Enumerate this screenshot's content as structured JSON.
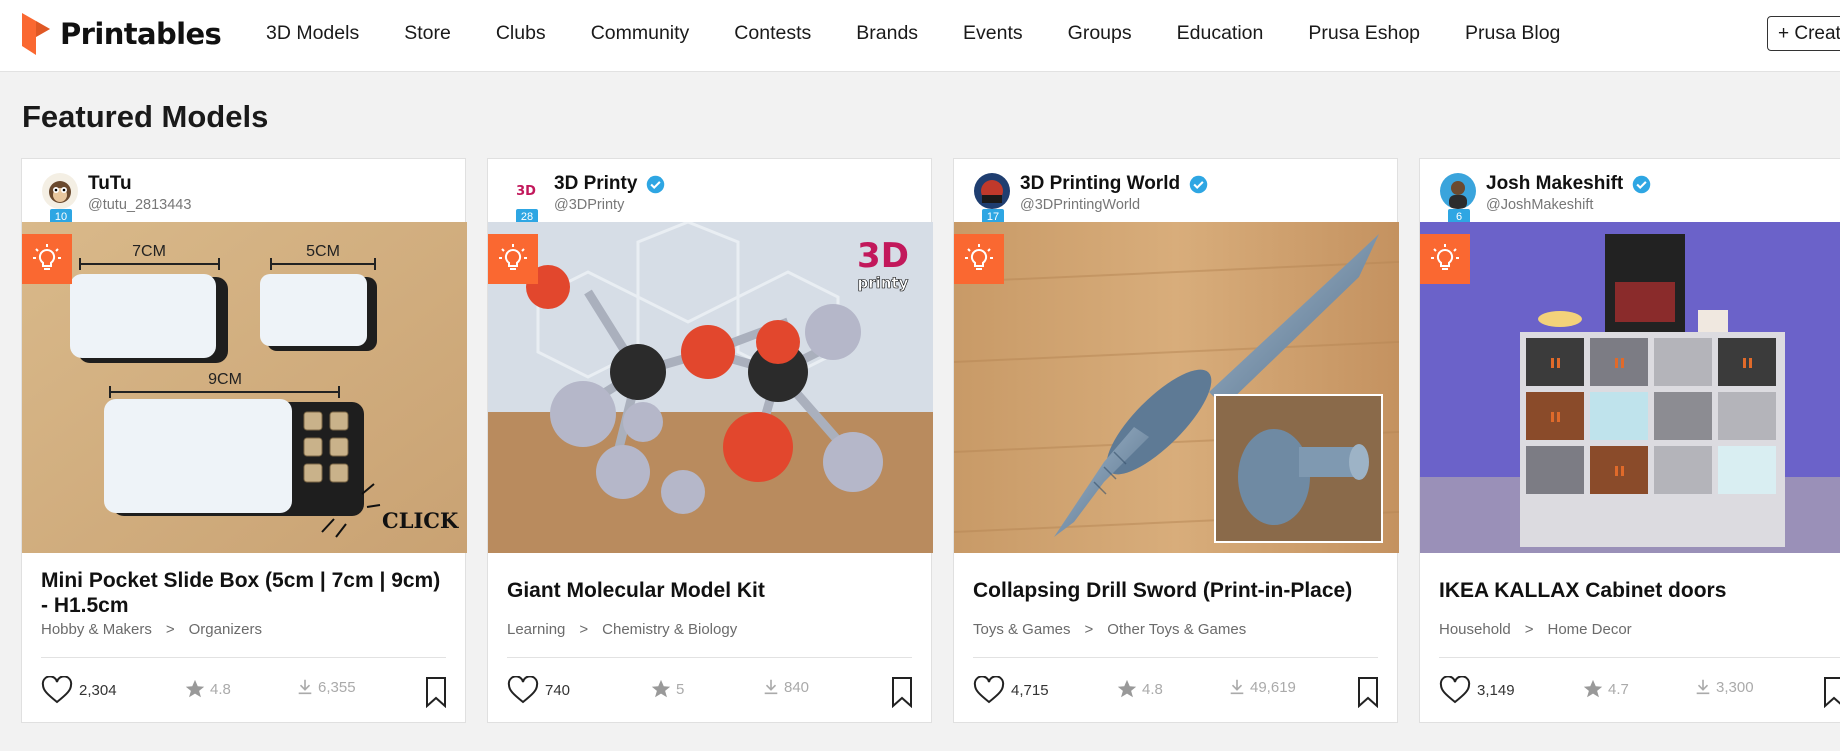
{
  "header": {
    "logo_text": "Printables",
    "nav": [
      "3D Models",
      "Store",
      "Clubs",
      "Community",
      "Contests",
      "Brands",
      "Events",
      "Groups",
      "Education",
      "Prusa Eshop",
      "Prusa Blog"
    ],
    "create_label": "+ Create"
  },
  "section_title": "Featured Models",
  "colors": {
    "brand": "#fa6831",
    "verified": "#2ea6e3"
  },
  "cards": [
    {
      "author": "TuTu",
      "handle": "@tutu_2813443",
      "level": "10",
      "verified": false,
      "title": "Mini Pocket Slide Box (5cm | 7cm | 9cm) - H1.5cm",
      "category": "Hobby & Makers",
      "subcategory": "Organizers",
      "likes": "2,304",
      "rating": "4.8",
      "downloads": "6,355",
      "image_labels": [
        "7CM",
        "5CM",
        "9CM",
        "CLICK"
      ]
    },
    {
      "author": "3D Printy",
      "handle": "@3DPrinty",
      "level": "28",
      "verified": true,
      "title": "Giant Molecular Model Kit",
      "category": "Learning",
      "subcategory": "Chemistry & Biology",
      "likes": "740",
      "rating": "5",
      "downloads": "840",
      "image_labels": [
        "3D",
        "printy"
      ]
    },
    {
      "author": "3D Printing World",
      "handle": "@3DPrintingWorld",
      "level": "17",
      "verified": true,
      "title": "Collapsing Drill Sword (Print-in-Place)",
      "category": "Toys & Games",
      "subcategory": "Other Toys & Games",
      "likes": "4,715",
      "rating": "4.8",
      "downloads": "49,619"
    },
    {
      "author": "Josh Makeshift",
      "handle": "@JoshMakeshift",
      "level": "6",
      "verified": true,
      "title": "IKEA KALLAX Cabinet doors",
      "category": "Household",
      "subcategory": "Home Decor",
      "likes": "3,149",
      "rating": "4.7",
      "downloads": "3,300"
    }
  ]
}
